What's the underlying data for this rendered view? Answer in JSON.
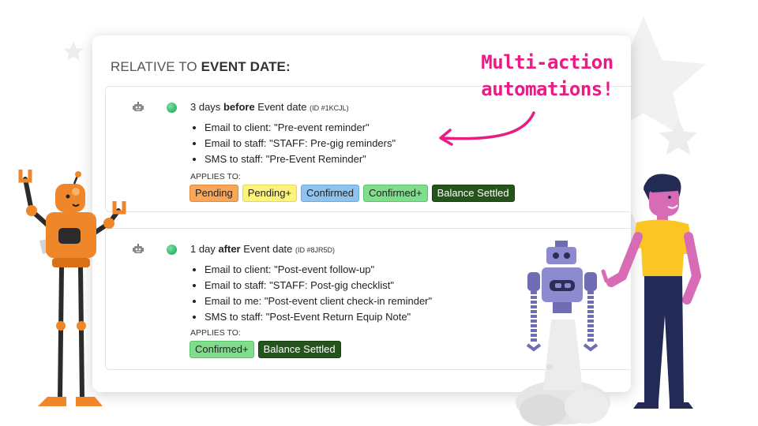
{
  "card": {
    "title_prefix": "RELATIVE TO ",
    "title_bold": "EVENT DATE:"
  },
  "rules": [
    {
      "amount": "3 days",
      "direction": "before",
      "suffix": " Event date",
      "id_label": "(ID #1KCJL)",
      "actions": [
        "Email to client: \"Pre-event reminder\"",
        "Email to staff: \"STAFF: Pre-gig reminders\"",
        "SMS to staff: \"Pre-Event Reminder\""
      ],
      "applies_label": "APPLIES TO:",
      "tags": [
        "Pending",
        "Pending+",
        "Confirmed",
        "Confirmed+",
        "Balance Settled"
      ]
    },
    {
      "amount": "1 day",
      "direction": "after",
      "suffix": " Event date",
      "id_label": "(ID #8JR5D)",
      "actions": [
        "Email to client: \"Post-event follow-up\"",
        "Email to staff: \"STAFF: Post-gig checklist\"",
        "Email to me: \"Post-event client check-in reminder\"",
        "SMS to staff: \"Post-Event Return Equip Note\""
      ],
      "applies_label": "APPLIES TO:",
      "tags": [
        "Confirmed+",
        "Balance Settled"
      ]
    }
  ],
  "callout": {
    "line1": "Multi-action",
    "line2": "automations!",
    "color": "#ea1b84"
  },
  "tag_colors": {
    "Pending": "#f9a659",
    "Pending+": "#fbf37a",
    "Confirmed": "#8fc3ef",
    "Confirmed+": "#7fdd8c",
    "Balance Settled": "#24541c"
  },
  "icons": {
    "rule_type": "robot-icon",
    "status": "green-status-dot"
  }
}
